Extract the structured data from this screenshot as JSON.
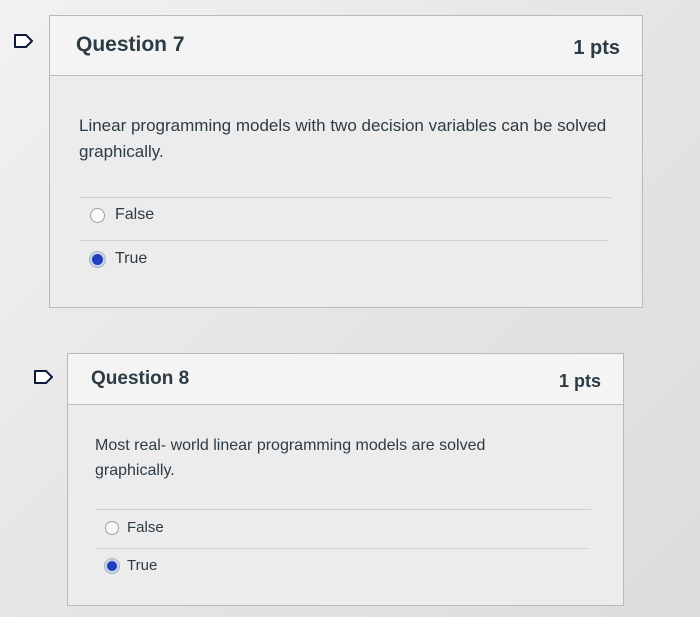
{
  "questions": [
    {
      "title": "Question 7",
      "points": "1 pts",
      "text": "Linear programming models with two decision variables can be solved graphically.",
      "answers": [
        {
          "label": "False",
          "selected": false
        },
        {
          "label": "True",
          "selected": true
        }
      ]
    },
    {
      "title": "Question 8",
      "points": "1 pts",
      "text": "Most real- world linear programming models are solved graphically.",
      "answers": [
        {
          "label": "False",
          "selected": false
        },
        {
          "label": "True",
          "selected": true
        }
      ]
    }
  ],
  "colors": {
    "text": "#2d3b45",
    "selected_radio": "#1f3fbf",
    "flag_outline": "#0d1a3a"
  },
  "icons": [
    "flag-question-icon",
    "radio-unchecked-icon",
    "radio-checked-icon"
  ]
}
